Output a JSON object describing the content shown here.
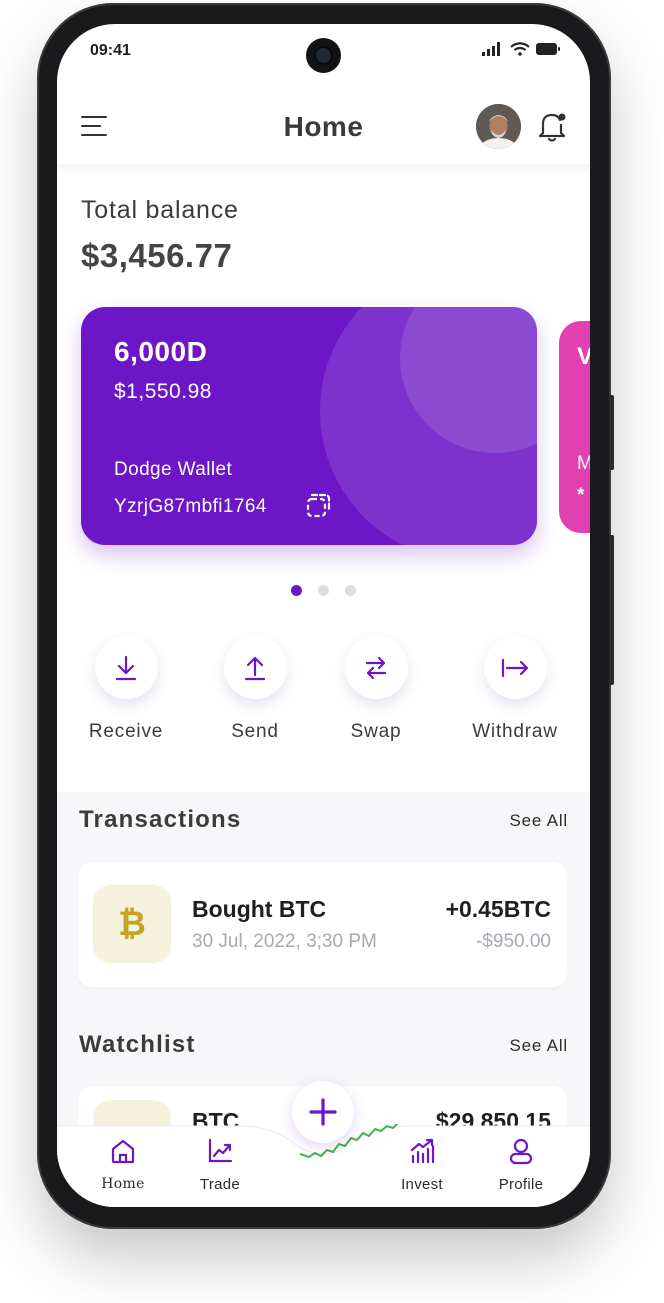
{
  "status_bar": {
    "time": "09:41"
  },
  "header": {
    "title": "Home"
  },
  "balance": {
    "label": "Total balance",
    "value": "$3,456.77"
  },
  "wallet_card": {
    "amount": "6,000D",
    "fiat_value": "$1,550.98",
    "name": "Dodge Wallet",
    "address": "YzrjG87mbfi1764",
    "color": "#6c16c7"
  },
  "next_card": {
    "title_fragment": "V",
    "name_fragment": "M",
    "address_fragment": "*",
    "color": "#e040b0"
  },
  "pager": {
    "count": 3,
    "active": 1
  },
  "actions": [
    {
      "label": "Receive",
      "icon": "download-icon"
    },
    {
      "label": "Send",
      "icon": "upload-icon"
    },
    {
      "label": "Swap",
      "icon": "swap-icon"
    },
    {
      "label": "Withdraw",
      "icon": "withdraw-icon"
    }
  ],
  "transactions": {
    "title": "Transactions",
    "see_all": "See All",
    "items": [
      {
        "coin_symbol": "₿",
        "title": "Bought BTC",
        "date": "30 Jul, 2022, 3;30 PM",
        "amount": "+0.45BTC",
        "fiat": "-$950.00"
      }
    ]
  },
  "watchlist": {
    "title": "Watchlist",
    "see_all": "See All",
    "items": [
      {
        "name": "BTC",
        "price": "$29,850.15"
      }
    ]
  },
  "bottom_nav": {
    "items": [
      {
        "label": "Home",
        "icon": "home-icon"
      },
      {
        "label": "Trade",
        "icon": "chart-icon"
      },
      {
        "label": "Invest",
        "icon": "invest-icon"
      },
      {
        "label": "Profile",
        "icon": "profile-icon"
      }
    ],
    "fab_icon": "plus-icon"
  },
  "colors": {
    "accent": "#6c16c7",
    "coin_gold": "#c4a420",
    "muted_text": "#a8a8b3"
  }
}
